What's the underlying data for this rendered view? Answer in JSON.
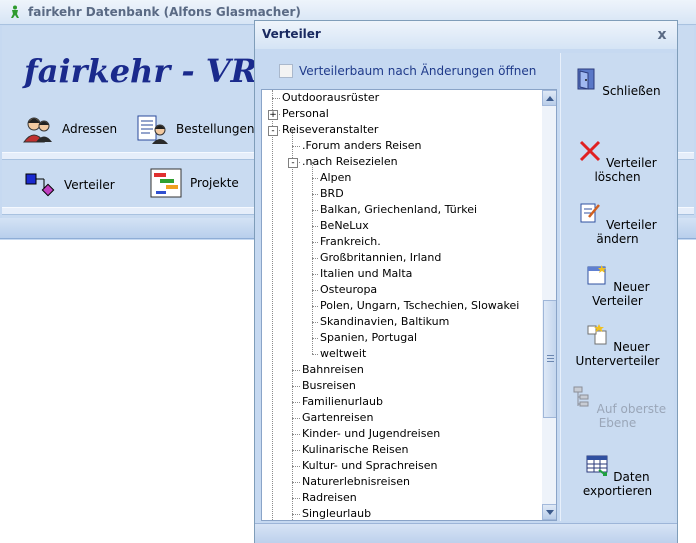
{
  "main_window": {
    "title": "fairkehr Datenbank (Alfons Glasmacher)",
    "heading": "fairkehr - VR - ",
    "nav": {
      "adressen": "Adressen",
      "bestellungen": "Bestellungen",
      "verteiler": "Verteiler",
      "projekte": "Projekte"
    }
  },
  "dialog": {
    "title": "Verteiler",
    "close_symbol": "x",
    "checkbox_label": "Verteilerbaum nach Änderungen öffnen",
    "checkbox_checked": false,
    "actions": {
      "close": "Schließen",
      "delete": "Verteiler löschen",
      "edit": "Verteiler ändern",
      "new": "Neuer Verteiler",
      "new_sub": "Neuer Unterverteiler",
      "top_level": "Auf oberste Ebene",
      "export": "Daten exportieren"
    },
    "tree": [
      {
        "label": "Outdoorausrüster",
        "level": 0
      },
      {
        "label": "Personal",
        "level": 0,
        "expander": "+"
      },
      {
        "label": "Reiseveranstalter",
        "level": 0,
        "expander": "-"
      },
      {
        "label": ".Forum anders Reisen",
        "level": 1
      },
      {
        "label": ".nach Reisezielen",
        "level": 1,
        "expander": "-"
      },
      {
        "label": "Alpen",
        "level": 2
      },
      {
        "label": "BRD",
        "level": 2
      },
      {
        "label": "Balkan, Griechenland, Türkei",
        "level": 2
      },
      {
        "label": "BeNeLux",
        "level": 2
      },
      {
        "label": "Frankreich.",
        "level": 2
      },
      {
        "label": "Großbritannien, Irland",
        "level": 2
      },
      {
        "label": "Italien und Malta",
        "level": 2
      },
      {
        "label": "Osteuropa",
        "level": 2
      },
      {
        "label": "Polen, Ungarn, Tschechien, Slowakei",
        "level": 2
      },
      {
        "label": "Skandinavien, Baltikum",
        "level": 2
      },
      {
        "label": "Spanien, Portugal",
        "level": 2
      },
      {
        "label": "weltweit",
        "level": 2
      },
      {
        "label": "Bahnreisen",
        "level": 1
      },
      {
        "label": "Busreisen",
        "level": 1
      },
      {
        "label": "Familienurlaub",
        "level": 1
      },
      {
        "label": "Gartenreisen",
        "level": 1
      },
      {
        "label": "Kinder- und Jugendreisen",
        "level": 1
      },
      {
        "label": "Kulinarische Reisen",
        "level": 1
      },
      {
        "label": "Kultur- und Sprachreisen",
        "level": 1
      },
      {
        "label": "Naturerlebnisreisen",
        "level": 1
      },
      {
        "label": "Radreisen",
        "level": 1
      },
      {
        "label": "Singleurlaub",
        "level": 1
      }
    ]
  }
}
